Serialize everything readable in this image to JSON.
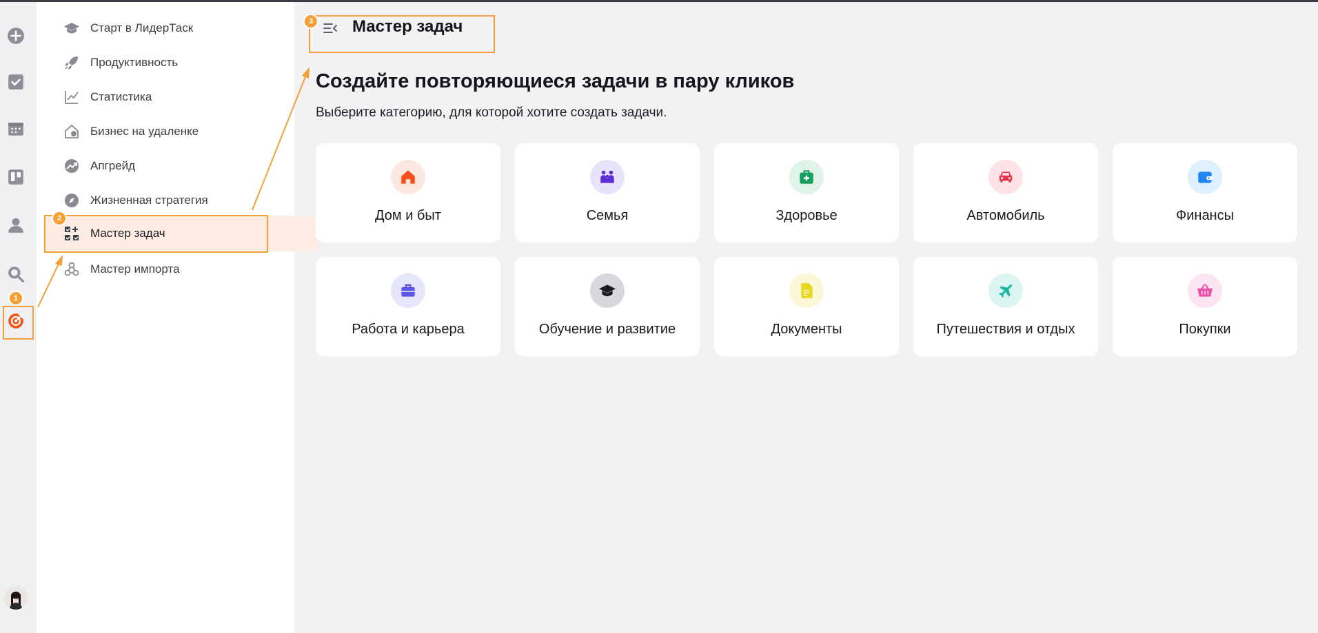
{
  "sidebar": {
    "items": [
      {
        "label": "Старт в ЛидерТаск",
        "icon": "graduation-cap-icon"
      },
      {
        "label": "Продуктивность",
        "icon": "rocket-icon"
      },
      {
        "label": "Статистика",
        "icon": "chart-line-icon"
      },
      {
        "label": "Бизнес на удаленке",
        "icon": "home-remote-icon"
      },
      {
        "label": "Апгрейд",
        "icon": "upgrade-icon"
      },
      {
        "label": "Жизненная стратегия",
        "icon": "compass-icon"
      },
      {
        "label": "Мастер задач",
        "icon": "task-grid-icon",
        "active": true
      },
      {
        "label": "Мастер импорта",
        "icon": "import-icon"
      }
    ]
  },
  "annotations": {
    "b1": "1",
    "b2": "2",
    "b3": "3"
  },
  "main": {
    "title": "Мастер задач",
    "headline": "Создайте повторяющиеся задачи в пару кликов",
    "subtext": "Выберите категорию, для которой хотите создать задачи.",
    "categories": [
      {
        "label": "Дом и быт",
        "icon": "house-icon",
        "color": "#f5501e",
        "bg": "#fde8df"
      },
      {
        "label": "Семья",
        "icon": "family-icon",
        "color": "#5b2fd6",
        "bg": "#e8e2fb"
      },
      {
        "label": "Здоровье",
        "icon": "medkit-icon",
        "color": "#17a05d",
        "bg": "#dff3e8"
      },
      {
        "label": "Автомобиль",
        "icon": "car-icon",
        "color": "#e8374d",
        "bg": "#fde2e6"
      },
      {
        "label": "Финансы",
        "icon": "wallet-icon",
        "color": "#1f86f2",
        "bg": "#def0fd"
      },
      {
        "label": "Работа и карьера",
        "icon": "briefcase-icon",
        "color": "#5b57e6",
        "bg": "#e5e5fb"
      },
      {
        "label": "Обучение и развитие",
        "icon": "graduation-cap-icon",
        "color": "#1b1b1f",
        "bg": "#d8d8dc"
      },
      {
        "label": "Документы",
        "icon": "document-icon",
        "color": "#e8d51e",
        "bg": "#fcf8d6"
      },
      {
        "label": "Путешествия и отдых",
        "icon": "airplane-icon",
        "color": "#19b8a4",
        "bg": "#dcf5f1"
      },
      {
        "label": "Покупки",
        "icon": "basket-icon",
        "color": "#ec4fa8",
        "bg": "#fde4f2"
      }
    ]
  }
}
